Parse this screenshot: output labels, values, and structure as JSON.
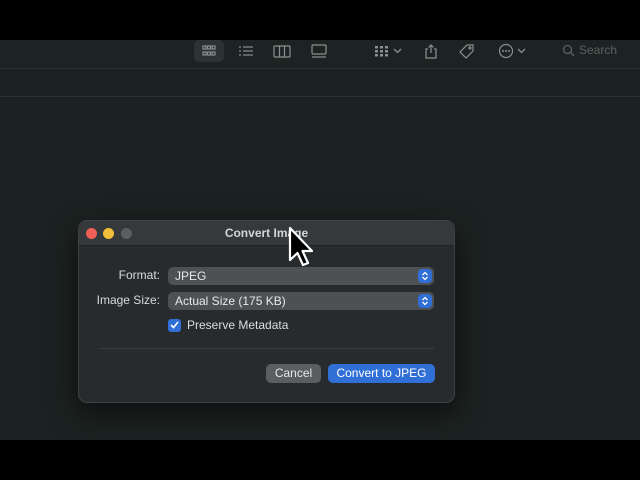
{
  "toolbar": {
    "icons": [
      "icon-view-grid",
      "icon-view-list",
      "icon-view-columns",
      "icon-view-gallery",
      "icon-group-by",
      "icon-share",
      "icon-tag",
      "icon-more"
    ],
    "search_label": "Search"
  },
  "dialog": {
    "title": "Convert Image",
    "format_label": "Format:",
    "format_value": "JPEG",
    "image_size_label": "Image Size:",
    "image_size_value": "Actual Size (175 KB)",
    "preserve_metadata_label": "Preserve Metadata",
    "preserve_metadata_checked": true,
    "cancel_label": "Cancel",
    "convert_label": "Convert to JPEG"
  },
  "colors": {
    "accent": "#2f6fd6",
    "close": "#ed5f57",
    "minimize": "#f0be3b",
    "zoom_disabled": "#5b5e60"
  }
}
